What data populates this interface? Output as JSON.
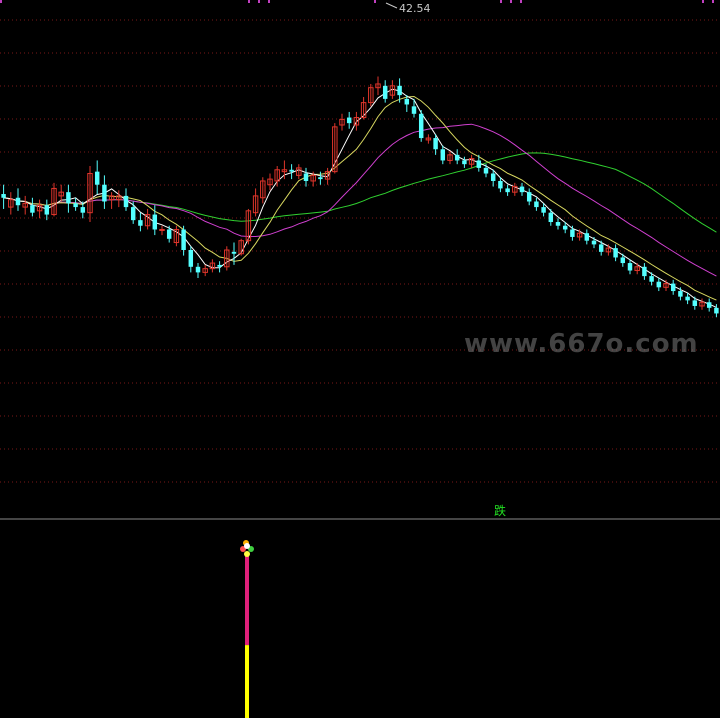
{
  "watermark": "www.667o.com",
  "peak_label": "42.54",
  "signal_label": "跌",
  "colors": {
    "up": "#e0352b",
    "down": "#54ffff",
    "ma5": "#ffffff",
    "ma10": "#d8d860",
    "ma30": "#d040d0",
    "ma60": "#30d030",
    "grid": "#7a1818",
    "separator": "#8a8a8a",
    "bar_upper": "#e0207a",
    "bar_lower": "#ffff00"
  },
  "chart_data": {
    "type": "candlestick",
    "price_range": [
      17.1,
      43.9
    ],
    "peak_value": 42.54,
    "candles": [
      [
        20,
        33.5,
        33.3,
        34.0,
        32.7
      ],
      [
        21,
        32.8,
        33.2,
        33.6,
        32.4
      ],
      [
        22,
        33.3,
        32.9,
        33.8,
        32.6
      ],
      [
        23,
        32.8,
        33.0,
        33.4,
        32.4
      ],
      [
        24,
        32.9,
        32.5,
        33.3,
        32.3
      ],
      [
        25,
        32.6,
        32.9,
        33.2,
        32.2
      ],
      [
        26,
        32.9,
        32.4,
        33.2,
        32.1
      ],
      [
        27,
        32.4,
        33.8,
        34.1,
        32.3
      ],
      [
        28,
        33.4,
        33.6,
        34.0,
        33.1
      ],
      [
        29,
        33.6,
        33.0,
        34.0,
        32.5
      ],
      [
        30,
        33.0,
        32.8,
        33.3,
        32.6
      ],
      [
        31,
        32.8,
        32.5,
        33.1,
        32.2
      ],
      [
        32,
        32.5,
        34.6,
        35.0,
        32.0
      ],
      [
        33,
        34.7,
        34.0,
        35.3,
        33.5
      ],
      [
        34,
        34.0,
        33.1,
        34.5,
        32.7
      ],
      [
        35,
        33.2,
        33.4,
        33.6,
        32.7
      ],
      [
        36,
        33.2,
        33.4,
        33.7,
        32.8
      ],
      [
        37,
        33.4,
        32.8,
        33.8,
        32.6
      ],
      [
        38,
        32.8,
        32.1,
        33.1,
        31.9
      ],
      [
        39,
        32.1,
        31.8,
        32.5,
        31.5
      ],
      [
        40,
        31.8,
        32.4,
        32.7,
        31.6
      ],
      [
        41,
        32.4,
        31.6,
        32.9,
        31.3
      ],
      [
        42,
        31.6,
        31.6,
        31.8,
        31.3
      ],
      [
        43,
        31.6,
        31.1,
        31.8,
        30.9
      ],
      [
        44,
        30.9,
        31.6,
        31.8,
        30.7
      ],
      [
        45,
        31.6,
        30.5,
        31.8,
        30.2
      ],
      [
        46,
        30.5,
        29.6,
        30.7,
        29.3
      ],
      [
        47,
        29.6,
        29.3,
        29.8,
        29.0
      ],
      [
        48,
        29.3,
        29.5,
        29.7,
        29.1
      ],
      [
        49,
        29.5,
        29.8,
        30.0,
        29.3
      ],
      [
        50,
        29.7,
        29.6,
        29.9,
        29.3
      ],
      [
        51,
        29.6,
        30.5,
        30.7,
        29.4
      ],
      [
        52,
        30.4,
        30.3,
        30.9,
        29.7
      ],
      [
        53,
        30.3,
        31.0,
        31.1,
        30.2
      ],
      [
        54,
        31.0,
        32.6,
        32.7,
        30.8
      ],
      [
        55,
        32.5,
        33.4,
        33.8,
        32.3
      ],
      [
        56,
        33.3,
        34.2,
        34.4,
        33.0
      ],
      [
        57,
        34.0,
        34.3,
        34.6,
        33.7
      ],
      [
        58,
        34.2,
        34.8,
        35.0,
        33.9
      ],
      [
        59,
        34.7,
        34.8,
        35.3,
        34.3
      ],
      [
        60,
        34.8,
        34.7,
        35.1,
        34.3
      ],
      [
        61,
        34.5,
        34.9,
        35.1,
        34.3
      ],
      [
        62,
        34.6,
        34.2,
        34.9,
        33.9
      ],
      [
        63,
        34.2,
        34.5,
        34.7,
        33.9
      ],
      [
        64,
        34.4,
        34.3,
        34.7,
        34.0
      ],
      [
        65,
        34.3,
        34.7,
        34.9,
        34.0
      ],
      [
        66,
        34.7,
        37.1,
        37.3,
        34.6
      ],
      [
        67,
        37.2,
        37.5,
        37.8,
        36.9
      ],
      [
        68,
        37.6,
        37.3,
        37.9,
        37.0
      ],
      [
        69,
        37.2,
        37.6,
        37.9,
        36.9
      ],
      [
        70,
        37.6,
        38.4,
        38.7,
        37.5
      ],
      [
        71,
        38.4,
        39.2,
        39.4,
        38.2
      ],
      [
        72,
        39.2,
        39.4,
        39.8,
        38.8
      ],
      [
        73,
        39.3,
        38.6,
        39.6,
        38.4
      ],
      [
        74,
        38.8,
        39.3,
        39.6,
        38.6
      ],
      [
        75,
        39.3,
        38.8,
        39.7,
        38.4
      ],
      [
        76,
        38.6,
        38.3,
        38.8,
        37.9
      ],
      [
        77,
        38.2,
        37.8,
        38.6,
        37.6
      ],
      [
        78,
        37.8,
        36.5,
        38.0,
        36.3
      ],
      [
        79,
        36.4,
        36.5,
        36.7,
        36.2
      ],
      [
        80,
        36.5,
        35.9,
        36.7,
        35.6
      ],
      [
        81,
        35.9,
        35.3,
        36.1,
        35.1
      ],
      [
        82,
        35.3,
        35.6,
        35.8,
        35.1
      ],
      [
        83,
        35.6,
        35.3,
        35.9,
        35.1
      ],
      [
        84,
        35.3,
        35.1,
        35.5,
        34.9
      ],
      [
        85,
        35.1,
        35.4,
        35.6,
        34.9
      ],
      [
        86,
        35.3,
        34.9,
        35.6,
        34.7
      ],
      [
        87,
        34.9,
        34.6,
        35.1,
        34.4
      ],
      [
        88,
        34.6,
        34.2,
        34.8,
        33.9
      ],
      [
        89,
        34.2,
        33.8,
        34.4,
        33.6
      ],
      [
        90,
        33.8,
        33.6,
        34.0,
        33.4
      ],
      [
        91,
        33.6,
        33.9,
        34.1,
        33.4
      ],
      [
        92,
        33.9,
        33.6,
        34.1,
        33.4
      ],
      [
        93,
        33.6,
        33.1,
        33.8,
        32.9
      ],
      [
        94,
        33.1,
        32.8,
        33.3,
        32.6
      ],
      [
        95,
        32.8,
        32.5,
        33.0,
        32.3
      ],
      [
        96,
        32.5,
        32.0,
        32.7,
        31.8
      ],
      [
        97,
        32.0,
        31.8,
        32.2,
        31.6
      ],
      [
        98,
        31.8,
        31.6,
        32.0,
        31.4
      ],
      [
        99,
        31.6,
        31.2,
        31.8,
        31.0
      ],
      [
        100,
        31.2,
        31.4,
        31.6,
        31.0
      ],
      [
        101,
        31.4,
        31.0,
        31.6,
        30.8
      ],
      [
        102,
        31.0,
        30.8,
        31.2,
        30.6
      ],
      [
        103,
        30.8,
        30.4,
        31.0,
        30.2
      ],
      [
        104,
        30.4,
        30.6,
        30.8,
        30.2
      ],
      [
        105,
        30.6,
        30.1,
        30.8,
        29.9
      ],
      [
        106,
        30.1,
        29.8,
        30.3,
        29.6
      ],
      [
        107,
        29.8,
        29.4,
        30.0,
        29.2
      ],
      [
        108,
        29.4,
        29.6,
        29.8,
        29.2
      ],
      [
        109,
        29.6,
        29.1,
        29.8,
        28.9
      ],
      [
        110,
        29.1,
        28.8,
        29.3,
        28.6
      ],
      [
        111,
        28.8,
        28.5,
        29.0,
        28.3
      ],
      [
        112,
        28.5,
        28.7,
        28.9,
        28.3
      ],
      [
        113,
        28.7,
        28.3,
        28.9,
        28.1
      ],
      [
        114,
        28.3,
        28.0,
        28.5,
        27.8
      ],
      [
        115,
        28.0,
        27.8,
        28.2,
        27.6
      ],
      [
        116,
        27.8,
        27.5,
        28.0,
        27.3
      ],
      [
        117,
        27.5,
        27.7,
        27.9,
        27.3
      ],
      [
        118,
        27.7,
        27.4,
        27.9,
        27.2
      ],
      [
        119,
        27.4,
        27.1,
        27.6,
        26.9
      ]
    ],
    "signal": {
      "label": "跌"
    },
    "indicator_bar": {
      "upper_value": 0.55,
      "lower_value": 0.45
    }
  }
}
